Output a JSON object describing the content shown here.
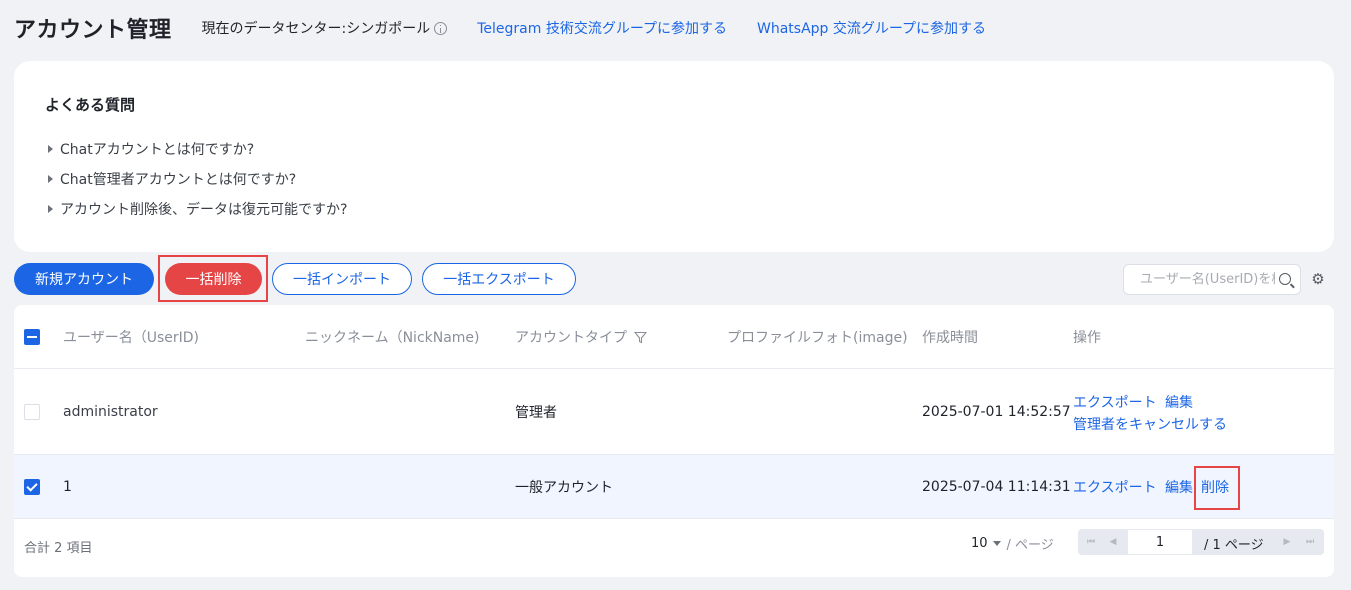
{
  "header": {
    "title": "アカウント管理",
    "datacenter": "現在のデータセンター:シンガポール",
    "telegram_link": "Telegram 技術交流グループに参加する",
    "whatsapp_link": "WhatsApp 交流グループに参加する"
  },
  "faq": {
    "title": "よくある質問",
    "items": [
      "Chatアカウントとは何ですか?",
      "Chat管理者アカウントとは何ですか?",
      "アカウント削除後、データは復元可能ですか?"
    ]
  },
  "toolbar": {
    "new_account": "新規アカウント",
    "bulk_delete": "一括削除",
    "bulk_import": "一括インポート",
    "bulk_export": "一括エクスポート",
    "search_placeholder": "ユーザー名(UserID)を検索"
  },
  "table": {
    "columns": [
      "ユーザー名（UserID)",
      "ニックネーム（NickName)",
      "アカウントタイプ",
      "プロファイルフォト(image)",
      "作成時間",
      "操作"
    ],
    "rows": [
      {
        "user_id": "administrator",
        "nickname": "",
        "type": "管理者",
        "image": "",
        "created": "2025-07-01 14:52:57",
        "actions": [
          "エクスポート",
          "編集",
          "管理者をキャンセルする"
        ],
        "checked": false
      },
      {
        "user_id": "1",
        "nickname": "",
        "type": "一般アカウント",
        "image": "",
        "created": "2025-07-04 11:14:31",
        "actions": [
          "エクスポート",
          "編集",
          "削除"
        ],
        "checked": true
      }
    ]
  },
  "footer": {
    "total": "合計 2 項目",
    "page_size": "10",
    "per_page": "/ ページ",
    "current_page": "1",
    "page_total": "/ 1 ページ"
  },
  "colors": {
    "primary": "#1c66e5",
    "danger": "#e54545",
    "selected_row": "#f0f5ff"
  }
}
